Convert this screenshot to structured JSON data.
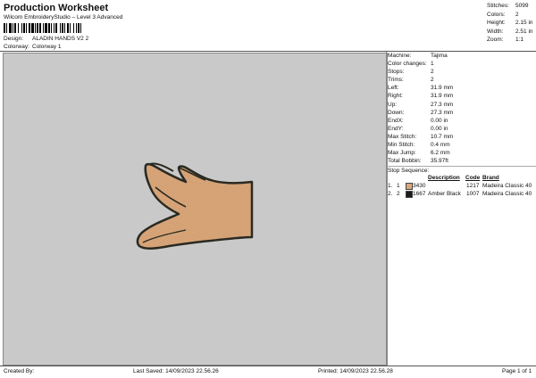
{
  "header": {
    "title": "Production Worksheet",
    "subtitle": "Wilcom EmbroideryStudio – Level 3 Advanced",
    "design_label": "Design:",
    "design_value": "ALADIN HANDS V2 2",
    "colorway_label": "Colorway:",
    "colorway_value": "Colorway 1"
  },
  "stats": [
    {
      "label": "Stitches:",
      "value": "5099"
    },
    {
      "label": "Colors:",
      "value": "2"
    },
    {
      "label": "Height:",
      "value": "2.15 in"
    },
    {
      "label": "Width:",
      "value": "2.51 in"
    },
    {
      "label": "Zoom:",
      "value": "1:1"
    }
  ],
  "machine_info": [
    {
      "label": "Machine:",
      "value": "Tajima"
    },
    {
      "label": "Color changes:",
      "value": "1"
    },
    {
      "label": "Stops:",
      "value": "2"
    },
    {
      "label": "Trims:",
      "value": "2"
    },
    {
      "label": "Left:",
      "value": "31.9 mm"
    },
    {
      "label": "Right:",
      "value": "31.9 mm"
    },
    {
      "label": "Up:",
      "value": "27.3 mm"
    },
    {
      "label": "Down:",
      "value": "27.3 mm"
    },
    {
      "label": "EndX:",
      "value": "0.00 in"
    },
    {
      "label": "EndY:",
      "value": "0.00 in"
    },
    {
      "label": "Max Stitch:",
      "value": "10.7 mm"
    },
    {
      "label": "Min Stitch:",
      "value": "0.4 mm"
    },
    {
      "label": "Max Jump:",
      "value": "6.2 mm"
    },
    {
      "label": "Total Bobbin:",
      "value": "35.97ft"
    }
  ],
  "stop_sequence": {
    "title": "Stop Sequence:",
    "headers": {
      "code": "Code",
      "description": "Description",
      "brand": "Brand"
    },
    "rows": [
      {
        "idx": "1.",
        "stop": "1",
        "swatch": "#d9a87a",
        "n": "3430",
        "description": "",
        "code": "1217",
        "brand": "Madeira Classic 40"
      },
      {
        "idx": "2.",
        "stop": "2",
        "swatch": "#1c1c1c",
        "n": "1667",
        "description": "Amber Black",
        "code": "1007",
        "brand": "Madeira Classic 40"
      }
    ]
  },
  "footer": {
    "created_by": "Created By:",
    "last_saved": "Last Saved: 14/09/2023 22.56.26",
    "printed": "Printed: 14/09/2023 22.56.28",
    "page": "Page 1 of 1"
  },
  "colors": {
    "canvas": "#c9c9c9",
    "skin": "#d9a87a",
    "outline": "#2a2a22"
  }
}
